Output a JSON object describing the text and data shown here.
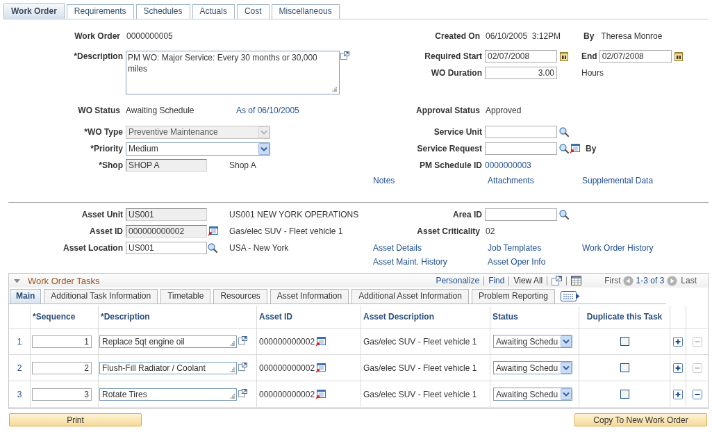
{
  "tabs": [
    {
      "label": "Work Order",
      "selected": true
    },
    {
      "label": "Requirements",
      "selected": false
    },
    {
      "label": "Schedules",
      "selected": false
    },
    {
      "label": "Actuals",
      "selected": false
    },
    {
      "label": "Cost",
      "selected": false
    },
    {
      "label": "Miscellaneous",
      "selected": false
    }
  ],
  "work_order": {
    "label": "Work Order",
    "value": "0000000005"
  },
  "description": {
    "label": "*Description",
    "value": "PM WO: Major Service: Every 30 months or 30,000 miles"
  },
  "created_on": {
    "label": "Created On",
    "value": "06/10/2005  3:12PM"
  },
  "created_by": {
    "label": "By",
    "value": "Theresa Monroe"
  },
  "required_start": {
    "label": "Required Start",
    "value": "02/07/2008"
  },
  "required_end": {
    "label": "End",
    "value": "02/07/2008"
  },
  "wo_duration": {
    "label": "WO Duration",
    "value": "3.00",
    "unit": "Hours"
  },
  "wo_status": {
    "label": "WO Status",
    "value": "Awaiting Schedule",
    "as_of_link": "As of 06/10/2005"
  },
  "approval_status": {
    "label": "Approval Status",
    "value": "Approved"
  },
  "wo_type": {
    "label": "*WO Type",
    "value": "Preventive Maintenance",
    "disabled": true
  },
  "priority": {
    "label": "*Priority",
    "value": "Medium",
    "disabled": false
  },
  "shop": {
    "label": "*Shop",
    "value": "SHOP A",
    "disabled": true,
    "description": "Shop A"
  },
  "service_unit": {
    "label": "Service Unit"
  },
  "service_request": {
    "label": "Service Request",
    "by_label": "By"
  },
  "pm_schedule_id": {
    "label": "PM Schedule ID",
    "value": "0000000003"
  },
  "links": [
    "Notes",
    "Attachments",
    "Supplemental Data"
  ],
  "asset_unit": {
    "label": "Asset Unit",
    "value": "US001",
    "disabled": true,
    "description": "US001 NEW YORK OPERATIONS"
  },
  "area_id": {
    "label": "Area ID"
  },
  "asset_id": {
    "label": "Asset ID",
    "value": "000000000002",
    "disabled": true,
    "description": "Gas/elec SUV - Fleet vehicle 1"
  },
  "asset_criticality": {
    "label": "Asset Criticality",
    "value": "02"
  },
  "asset_location": {
    "label": "Asset Location",
    "value": "US001",
    "disabled": false,
    "description": "USA - New York"
  },
  "asset_links": [
    "Asset Details",
    "Job Templates",
    "Work Order History",
    "Asset Maint. History",
    "Asset Oper Info"
  ],
  "tasks": {
    "title": "Work Order Tasks",
    "expanded": true,
    "nav": {
      "personalize": "Personalize",
      "find": "Find",
      "view_all": "View All",
      "first": "First",
      "range": "1-3 of 3",
      "last": "Last",
      "prev_disabled": true,
      "next_disabled": true
    },
    "tabs": [
      {
        "label": "Main",
        "selected": true
      },
      {
        "label": "Additional Task Information",
        "selected": false
      },
      {
        "label": "Timetable",
        "selected": false
      },
      {
        "label": "Resources",
        "selected": false
      },
      {
        "label": "Asset Information",
        "selected": false
      },
      {
        "label": "Additional Asset Information",
        "selected": false
      },
      {
        "label": "Problem Reporting",
        "selected": false
      }
    ],
    "columns": [
      "*Sequence",
      "*Description",
      "Asset ID",
      "Asset Description",
      "Status",
      "Duplicate this Task"
    ],
    "rows": [
      {
        "number": "1",
        "sequence": "1",
        "description": "Replace 5qt engine oil",
        "asset_id": "000000000002",
        "asset_description": "Gas/elec SUV - Fleet vehicle 1",
        "status": "Awaiting Schedu",
        "duplicate": false,
        "delete_disabled": true
      },
      {
        "number": "2",
        "sequence": "2",
        "description": "Flush-Fill Radiator / Coolant",
        "asset_id": "000000000002",
        "asset_description": "Gas/elec SUV - Fleet vehicle 1",
        "status": "Awaiting Schedu",
        "duplicate": false,
        "delete_disabled": true
      },
      {
        "number": "3",
        "sequence": "3",
        "description": "Rotate Tires",
        "asset_id": "000000000002",
        "asset_description": "Gas/elec SUV - Fleet vehicle 1",
        "status": "Awaiting Schedu",
        "duplicate": false,
        "delete_disabled": false
      }
    ]
  },
  "buttons": [
    "Print",
    "Copy To New Work Order"
  ]
}
